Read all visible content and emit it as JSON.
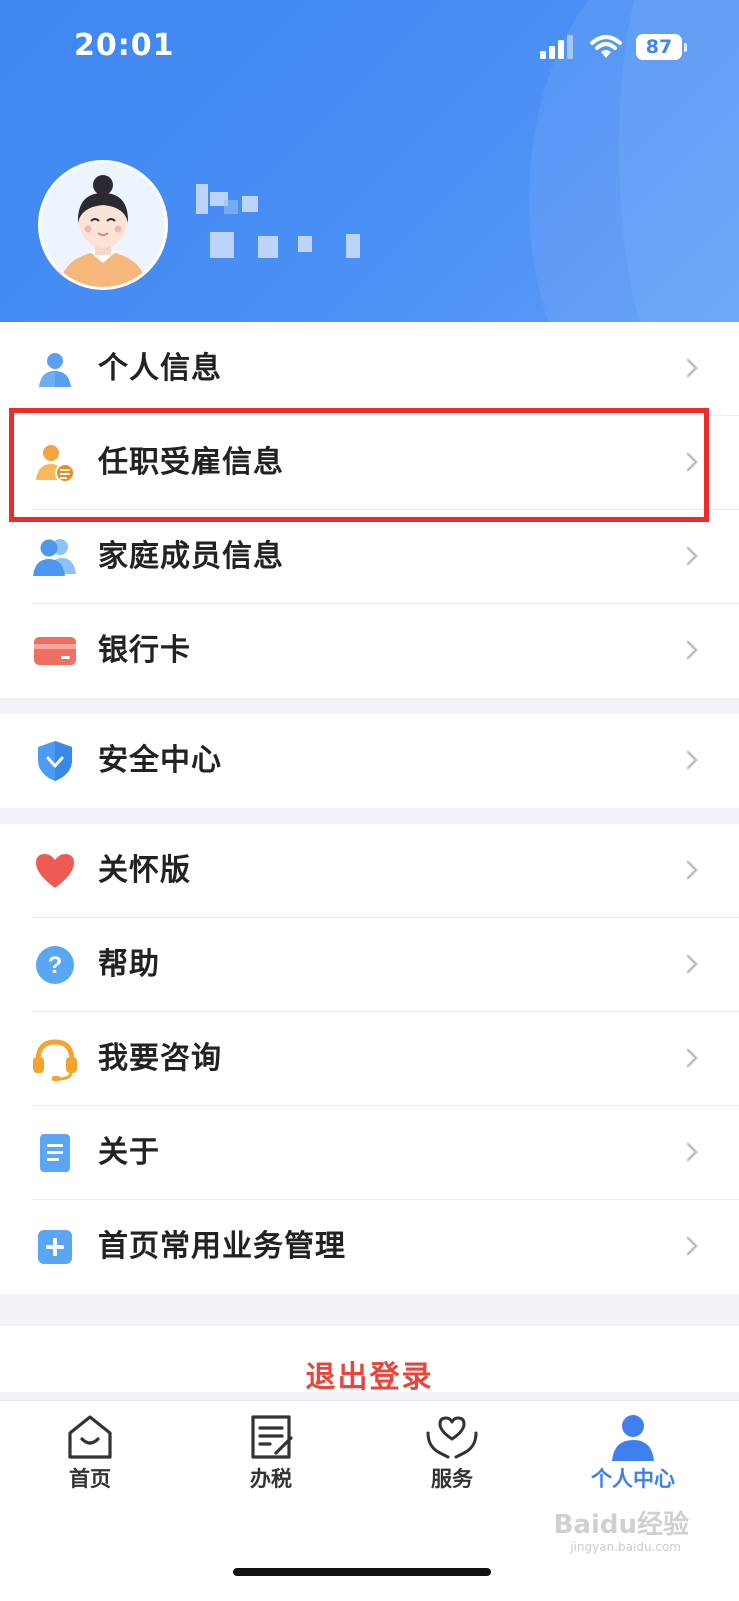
{
  "status_bar": {
    "time": "20:01",
    "battery": "87"
  },
  "menu_group_1": [
    {
      "label": "个人信息"
    },
    {
      "label": "任职受雇信息"
    },
    {
      "label": "家庭成员信息"
    },
    {
      "label": "银行卡"
    }
  ],
  "menu_group_2": [
    {
      "label": "安全中心"
    }
  ],
  "menu_group_3": [
    {
      "label": "关怀版"
    },
    {
      "label": "帮助"
    },
    {
      "label": "我要咨询"
    },
    {
      "label": "关于"
    },
    {
      "label": "首页常用业务管理"
    }
  ],
  "logout_label": "退出登录",
  "tabs": [
    {
      "label": "首页"
    },
    {
      "label": "办税"
    },
    {
      "label": "服务"
    },
    {
      "label": "个人中心"
    }
  ],
  "watermark": {
    "text": "Baidu经验",
    "sub": "jingyan.baidu.com"
  },
  "colors": {
    "header": "#3f86f2",
    "accent": "#3f7ff0",
    "logout": "#e8453c",
    "highlight": "#ee2a2a"
  }
}
